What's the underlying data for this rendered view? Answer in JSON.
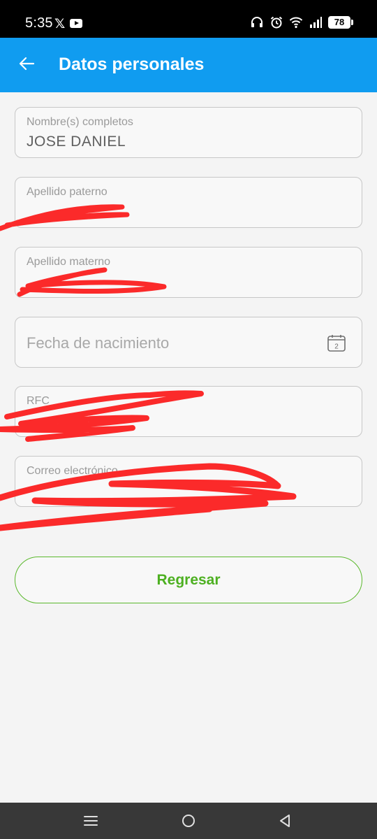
{
  "status_bar": {
    "time": "5:35",
    "x_logo": "𝕏",
    "battery": "78",
    "icons": [
      "x-logo-icon",
      "youtube-icon",
      "headphones-icon",
      "alarm-icon",
      "wifi-icon",
      "signal-icon",
      "battery-icon"
    ]
  },
  "app_bar": {
    "title": "Datos personales",
    "back_icon": "arrow-left-icon",
    "color": "#109cf0"
  },
  "form": {
    "nombre": {
      "label": "Nombre(s) completos",
      "value": "JOSE DANIEL"
    },
    "apellido_paterno": {
      "label": "Apellido paterno"
    },
    "apellido_materno": {
      "label": "Apellido materno"
    },
    "fecha_nacimiento": {
      "placeholder": "Fecha de nacimiento",
      "icon": "calendar-icon",
      "icon_text": "2"
    },
    "rfc": {
      "label": "RFC"
    },
    "correo": {
      "label": "Correo electrónico"
    }
  },
  "actions": {
    "regresar_label": "Regresar",
    "accent": "#4db021"
  },
  "nav_bar": {
    "icons": [
      "menu-icon",
      "home-icon",
      "back-icon"
    ]
  }
}
